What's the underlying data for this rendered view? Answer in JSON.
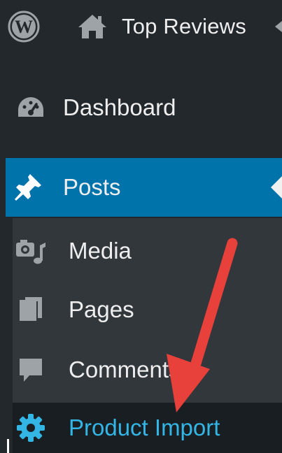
{
  "adminbar": {
    "site_title": "Top Reviews",
    "icons": [
      "wordpress-logo-icon",
      "home-icon"
    ]
  },
  "menu": {
    "dashboard": {
      "label": "Dashboard",
      "icon": "dashboard-gauge-icon"
    },
    "posts": {
      "label": "Posts",
      "icon": "pushpin-icon",
      "state": "active"
    }
  },
  "submenu": {
    "items": [
      {
        "label": "Media",
        "icon": "media-icon"
      },
      {
        "label": "Pages",
        "icon": "pages-icon"
      },
      {
        "label": "Comments",
        "icon": "comment-bubble-icon"
      },
      {
        "label": "Product Import",
        "icon": "gear-icon",
        "state": "highlighted"
      }
    ]
  },
  "annotation": {
    "type": "red-arrow",
    "points_to": "Product Import"
  },
  "colors": {
    "sidebar_bg": "#23282d",
    "submenu_bg": "#32373c",
    "active_bg": "#0073aa",
    "highlight_text": "#33b5e5",
    "arrow": "#e8403a"
  }
}
